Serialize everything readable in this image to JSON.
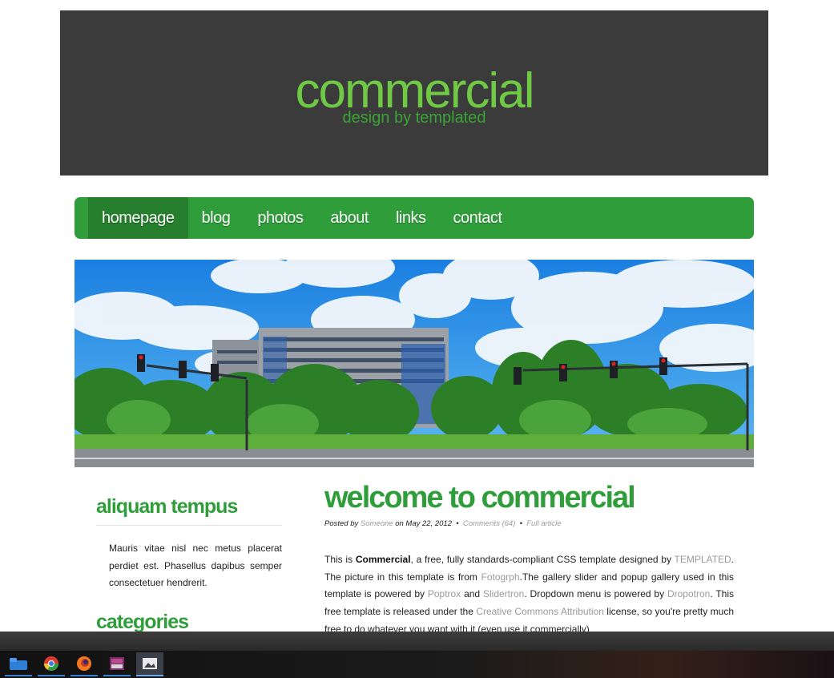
{
  "header": {
    "title": "commercial",
    "subtitle": "design by templated"
  },
  "nav": {
    "items": [
      {
        "label": "homepage",
        "active": true
      },
      {
        "label": "blog",
        "active": false
      },
      {
        "label": "photos",
        "active": false
      },
      {
        "label": "about",
        "active": false
      },
      {
        "label": "links",
        "active": false
      },
      {
        "label": "contact",
        "active": false
      }
    ]
  },
  "sidebar": {
    "section1_title": "aliquam tempus",
    "section1_text": "Mauris vitae nisl nec metus placerat perdiet est. Phasellus dapibus semper consectetuer hendrerit.",
    "section2_title": "categories"
  },
  "main": {
    "title": "welcome to commercial",
    "byline": {
      "posted_by_label": "Posted by",
      "author": "Someone",
      "on_label": "on",
      "date": "May 22, 2012",
      "separator": "•",
      "comments": "Comments (64)",
      "full_article": "Full article"
    },
    "article": {
      "t1": "This   is ",
      "brand": "Commercial",
      "t2": ", a free, fully standards-compliant CSS template designed by ",
      "link_templated": "TEMPLATED",
      "t3": ". The picture in this template is from ",
      "link_fotogrph": "Fotogrph",
      "t4": ".The gallery slider and popup gallery used in this template is powered by ",
      "link_poptrox": "Poptrox",
      "t5": "  and ",
      "link_slidertron": "Slidertron",
      "t6": ". Dropdown menu is powered by ",
      "link_dropotron": "Dropotron",
      "t7": ". This free template is released under the ",
      "link_cc": "Creative Commons Attribution",
      "t8": " license, so you're pretty much free to do whatever you want with it (even use it commercially)"
    }
  },
  "taskbar": {
    "icons": [
      "file-manager-icon",
      "chrome-icon",
      "firefox-icon",
      "image-viewer-icon",
      "screenshot-app-icon"
    ],
    "accent_color": "#3c7fd0"
  },
  "colors": {
    "header_bg": "#3b3b3b",
    "brand_green": "#2f9e3a",
    "logo_green": "#6fc945",
    "link_gray": "#9a9a9a"
  }
}
